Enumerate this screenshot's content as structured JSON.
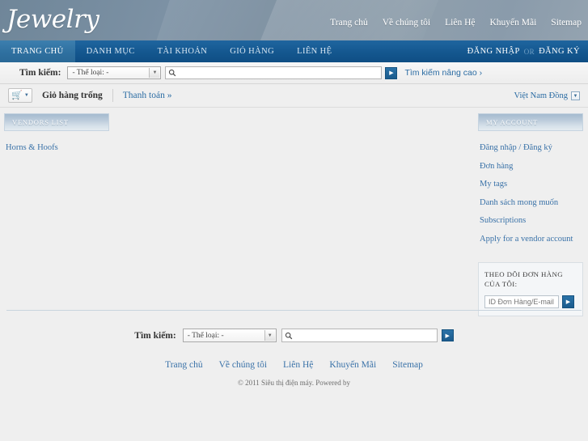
{
  "header": {
    "logo_text": "Jewelry",
    "top_nav": [
      {
        "label": "Trang chủ"
      },
      {
        "label": "Về chúng tôi"
      },
      {
        "label": "Liên Hệ"
      },
      {
        "label": "Khuyến Mãi"
      },
      {
        "label": "Sitemap"
      }
    ]
  },
  "mainnav": {
    "tabs": [
      {
        "label": "TRANG CHỦ",
        "active": true
      },
      {
        "label": "DANH MỤC",
        "active": false
      },
      {
        "label": "TÀI KHOẢN",
        "active": false
      },
      {
        "label": "GIỎ HÀNG",
        "active": false
      },
      {
        "label": "LIÊN HỆ",
        "active": false
      }
    ],
    "login_label": "ĐĂNG NHẬP",
    "or_label": "OR",
    "register_label": "ĐĂNG KÝ"
  },
  "search": {
    "label": "Tìm kiếm:",
    "category_value": "- Thể loại: -",
    "input_value": "",
    "input_placeholder": "",
    "advanced_label": "Tìm kiếm nâng cao ›",
    "search_icon": "search-icon",
    "go_icon": "arrow-right-icon"
  },
  "cartbar": {
    "cart_icon": "shopping-cart-icon",
    "cart_dropdown_icon": "chevron-down-icon",
    "cart_status": "Giỏ hàng trống",
    "checkout_label": "Thanh toán »",
    "currency_label": "Việt Nam Đồng",
    "currency_icon": "dropdown-box-icon"
  },
  "sidebar_left": {
    "title": "VENDORS LIST",
    "links": [
      {
        "label": "Horns & Hoofs"
      }
    ]
  },
  "sidebar_right": {
    "title": "MY ACCOUNT",
    "links": [
      {
        "label": "Đăng nhập / Đăng ký"
      },
      {
        "label": "Đơn hàng"
      },
      {
        "label": "My tags"
      },
      {
        "label": "Danh sách mong muốn"
      },
      {
        "label": "Subscriptions"
      },
      {
        "label": "Apply for a vendor account"
      }
    ],
    "track_title": "THEO DÕI ĐƠN HÀNG CỦA TÔI:",
    "track_placeholder": "ID Đơn Hàng/E-mail",
    "track_value": "",
    "track_go_icon": "arrow-right-icon"
  },
  "footer": {
    "search_label": "Tìm kiếm:",
    "category_value": "- Thể loại: -",
    "input_value": "",
    "search_icon": "search-icon",
    "go_icon": "arrow-right-icon",
    "nav": [
      {
        "label": "Trang chủ"
      },
      {
        "label": "Về chúng tôi"
      },
      {
        "label": "Liên Hệ"
      },
      {
        "label": "Khuyến Mãi"
      },
      {
        "label": "Sitemap"
      }
    ],
    "copyright": "© 2011 Siêu thị điện máy. Powered by"
  },
  "colors": {
    "header_blue_grey": "#7f93a6",
    "nav_blue": "#14578f",
    "nav_active_blue": "#2e6f9f",
    "link_blue": "#3a72a8",
    "page_bg": "#efefef"
  }
}
